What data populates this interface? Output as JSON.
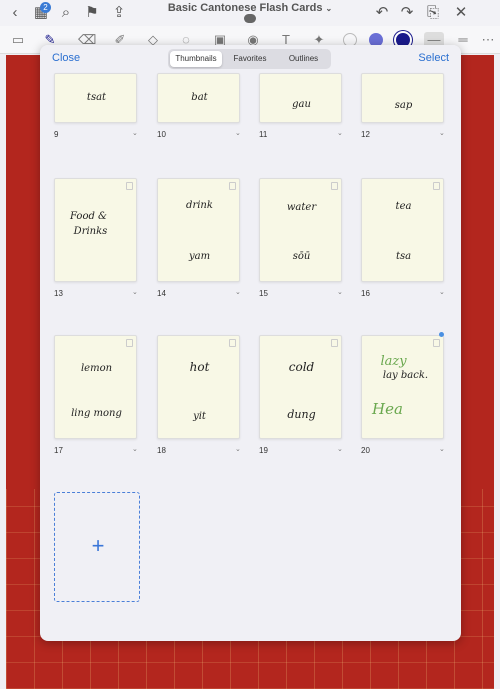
{
  "app": {
    "document_title": "Basic Cantonese Flash Cards",
    "badge_count": "2"
  },
  "toolbar_icons": [
    "back-icon",
    "grid-icon",
    "search-icon",
    "bookmark-icon",
    "share-icon",
    "undo-icon",
    "redo-icon",
    "export-icon",
    "close-icon"
  ],
  "tools": [
    "pen",
    "eraser",
    "highlighter",
    "shapes",
    "lasso",
    "image",
    "camera",
    "text",
    "laser"
  ],
  "colors": {
    "accent": "#2a6fd0",
    "page_red": "#b3261e",
    "thumb_bg": "#f8f8e6",
    "ink_green": "#6aa84f",
    "color_dot_1": "#6a6fd6",
    "color_dot_2": "#1a1a8c"
  },
  "modal": {
    "close_label": "Close",
    "select_label": "Select",
    "tabs": [
      {
        "label": "Thumbnails",
        "active": true
      },
      {
        "label": "Favorites",
        "active": false
      },
      {
        "label": "Outlines",
        "active": false
      }
    ]
  },
  "pages": [
    {
      "num": "9",
      "top": "tsat",
      "bottom": ""
    },
    {
      "num": "10",
      "top": "bat",
      "bottom": ""
    },
    {
      "num": "11",
      "top": "gau",
      "bottom": ""
    },
    {
      "num": "12",
      "top": "sap",
      "bottom": ""
    },
    {
      "num": "13",
      "top": "Food &",
      "bottom": "Drinks"
    },
    {
      "num": "14",
      "top": "drink",
      "bottom": "yam"
    },
    {
      "num": "15",
      "top": "water",
      "bottom": "sōū"
    },
    {
      "num": "16",
      "top": "tea",
      "bottom": "tsa"
    },
    {
      "num": "17",
      "top": "lemon",
      "bottom": "ling mong"
    },
    {
      "num": "18",
      "top": "hot",
      "bottom": "yit"
    },
    {
      "num": "19",
      "top": "cold",
      "bottom": "dung"
    },
    {
      "num": "20",
      "top": "lazy",
      "top2": "lay back.",
      "bottom": "Hea"
    }
  ],
  "add_page_symbol": "+"
}
